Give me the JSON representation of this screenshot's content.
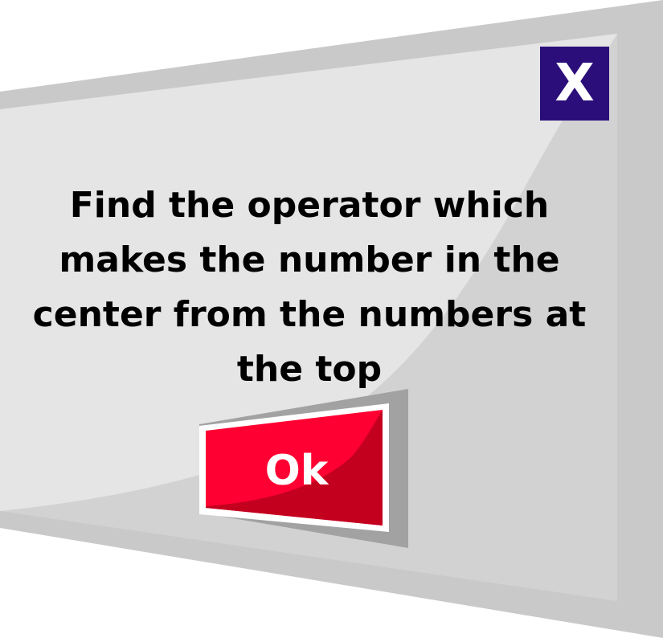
{
  "dialog": {
    "message": "Find the operator which makes the number in the center from the numbers at the top",
    "close_label": "X",
    "ok_label": "Ok"
  },
  "colors": {
    "panel_light": "#e4e4e4",
    "panel_mid": "#d3d3d3",
    "panel_frame": "#c4c4c4",
    "close_bg": "#2b0e7a",
    "ok_red": "#ff0033",
    "ok_dark_red": "#c4001f",
    "ok_shadow": "#9c9c9c"
  },
  "icons": {
    "close": "close-icon"
  }
}
